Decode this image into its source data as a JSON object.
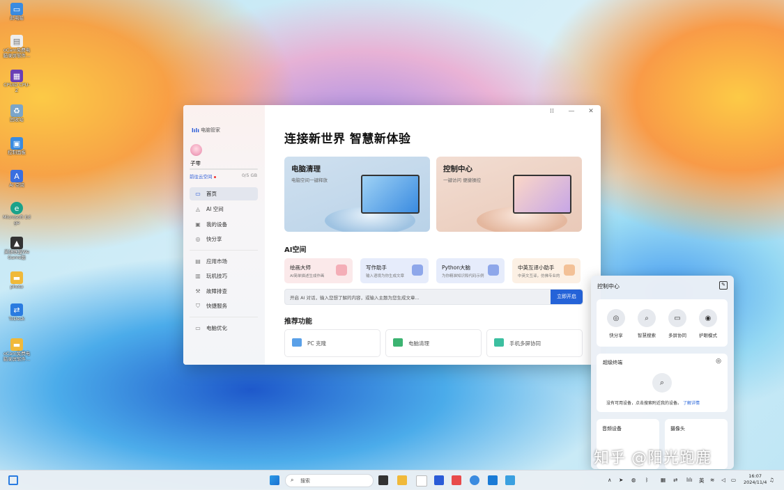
{
  "desktop": {
    "icons": [
      {
        "label": "此电脑",
        "icon": "computer-icon",
        "color": "#3a8be0"
      },
      {
        "label": "oCam免费电脑录屏软件...",
        "icon": "file-icon",
        "color": "#ffffff"
      },
      {
        "label": "CPUID CPU-Z",
        "icon": "cpu-icon",
        "color": "#6a3fb5"
      },
      {
        "label": "回收站",
        "icon": "recycle-bin-icon",
        "color": "#7aa5c9"
      },
      {
        "label": "控制面板",
        "icon": "control-panel-icon",
        "color": "#3a8be0"
      },
      {
        "label": "AI 空间",
        "icon": "ai-icon",
        "color": "#3a6fe0"
      },
      {
        "label": "Microsoft Edge",
        "icon": "edge-icon",
        "color": "#1ba28a"
      },
      {
        "label": "英雄联盟WeGame版",
        "icon": "game-icon",
        "color": "#333333"
      },
      {
        "label": "photo",
        "icon": "folder-icon",
        "color": "#f0b93a"
      },
      {
        "label": "ToDesk",
        "icon": "todesk-icon",
        "color": "#2a7be0"
      },
      {
        "label": "oCam免费电脑录屏软件...",
        "icon": "folder-icon",
        "color": "#f0b93a"
      }
    ]
  },
  "window": {
    "app_name": "电脑管家",
    "controls": {
      "snap": "⁞⁞",
      "minimize": "—",
      "close": "✕"
    },
    "sidebar": {
      "user_name": "子零",
      "cloud_link": "前往云空间",
      "storage": "0/5 GB",
      "nav_primary": [
        {
          "label": "首页",
          "icon": "laptop-icon",
          "glyph": "▭"
        },
        {
          "label": "AI 空间",
          "icon": "ai-space-icon",
          "glyph": "◬"
        },
        {
          "label": "我的设备",
          "icon": "devices-icon",
          "glyph": "▣"
        },
        {
          "label": "快分享",
          "icon": "share-icon",
          "glyph": "((•))"
        }
      ],
      "nav_secondary": [
        {
          "label": "应用市场",
          "icon": "app-market-icon",
          "glyph": "▤"
        },
        {
          "label": "玩机技巧",
          "icon": "tips-icon",
          "glyph": "▥"
        },
        {
          "label": "故障排查",
          "icon": "wrench-icon",
          "glyph": "🔧"
        },
        {
          "label": "快捷服务",
          "icon": "shield-icon",
          "glyph": "⛉"
        }
      ],
      "nav_tertiary": [
        {
          "label": "电脑优化",
          "icon": "optimize-icon",
          "glyph": "▭"
        }
      ]
    },
    "main": {
      "headline": "连接新世界 智慧新体验",
      "cards": [
        {
          "title": "电脑清理",
          "subtitle": "电脑空间一键释放"
        },
        {
          "title": "控制中心",
          "subtitle": "一键访问 便捷操控"
        }
      ],
      "ai_section_title": "AI空间",
      "ai_tools": [
        {
          "title": "绘画大师",
          "subtitle": "AI简单描述生成作画",
          "bg": "#fbe9ea",
          "icon_color": "#f2a3ae"
        },
        {
          "title": "写作助手",
          "subtitle": "输入语境为你生成文章",
          "bg": "#e6ecfb",
          "icon_color": "#7e9be6"
        },
        {
          "title": "Python大脑",
          "subtitle": "为你精准知识和代码示例",
          "bg": "#e6ecfb",
          "icon_color": "#7e9be6"
        },
        {
          "title": "中英互译小助手",
          "subtitle": "中英文互译，仿佛专业的",
          "bg": "#fcf0e4",
          "icon_color": "#f1b98a"
        }
      ],
      "chat_placeholder": "开启 AI 对话，输入您想了解的内容，或输入主题为您生成文章...",
      "chat_button": "立即开启",
      "recommend_title": "推荐功能",
      "recommend": [
        {
          "label": "PC 克隆",
          "icon": "clone-icon",
          "color": "#5aa0e8"
        },
        {
          "label": "电脑清理",
          "icon": "broom-icon",
          "color": "#3cb371"
        },
        {
          "label": "手机多屏协同",
          "icon": "multiscreen-icon",
          "color": "#3cbfa0"
        }
      ]
    }
  },
  "control_center": {
    "title": "控制中心",
    "quick_actions": [
      {
        "label": "快分享",
        "icon": "share-icon",
        "glyph": "((•))"
      },
      {
        "label": "智慧搜索",
        "icon": "search-icon",
        "glyph": "⌕"
      },
      {
        "label": "多屏协同",
        "icon": "multiscreen-icon",
        "glyph": "▭"
      },
      {
        "label": "护眼模式",
        "icon": "eye-icon",
        "glyph": "◉"
      }
    ],
    "super_terminal": {
      "title": "超级终端",
      "empty_text": "没有可用设备，点击搜索附近我的设备。",
      "learn_more": "了解详情"
    },
    "audio_title": "音频设备",
    "camera_title": "摄像头"
  },
  "taskbar": {
    "search_placeholder": "搜索",
    "tray_lang": "英",
    "time": "16:07",
    "date": "2024/11/4"
  },
  "watermark": "知乎 @阳光跑鹿"
}
